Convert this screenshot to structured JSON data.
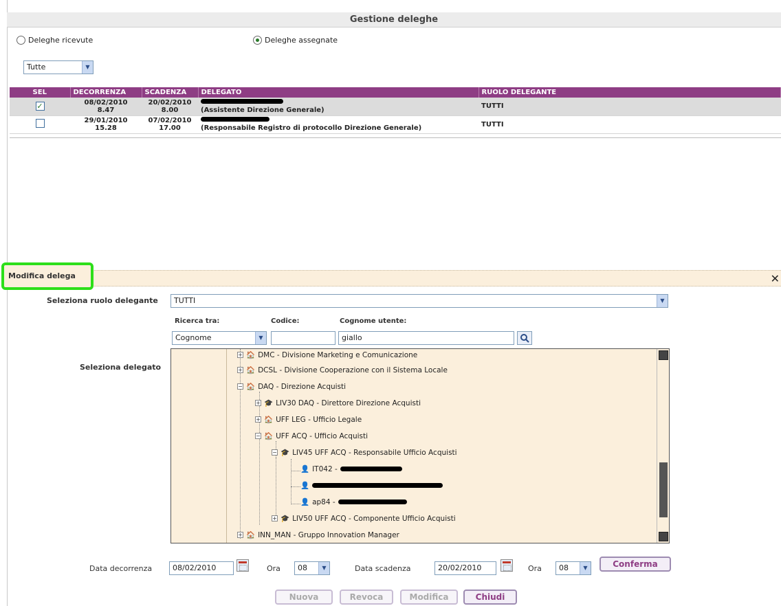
{
  "title": "Gestione deleghe",
  "filters": {
    "radio_received": "Deleghe ricevute",
    "radio_assigned": "Deleghe assegnate",
    "select_value": "Tutte"
  },
  "table": {
    "headers": [
      "SEL",
      "DECORRENZA",
      "SCADENZA",
      "DELEGATO",
      "RUOLO DELEGANTE"
    ],
    "rows": [
      {
        "checked": true,
        "dec_date": "08/02/2010",
        "dec_time": "8.47",
        "sca_date": "20/02/2010",
        "sca_time": "8.00",
        "delegato_role": "(Assistente Direzione Generale)",
        "ruolo": "TUTTI"
      },
      {
        "checked": false,
        "dec_date": "29/01/2010",
        "dec_time": "15.28",
        "sca_date": "07/02/2010",
        "sca_time": "17.00",
        "delegato_role": "(Responsabile Registro di protocollo Direzione Generale)",
        "ruolo": "TUTTI"
      }
    ]
  },
  "edit": {
    "section_title": "Modifica delega",
    "ruolo_label": "Seleziona ruolo delegante",
    "ruolo_value": "TUTTI",
    "ricerca_label": "Ricerca tra:",
    "ricerca_value": "Cognome",
    "codice_label": "Codice:",
    "codice_value": "",
    "cognome_label": "Cognome utente:",
    "cognome_value": "giallo",
    "delegato_label": "Seleziona delegato",
    "tree": [
      "DMC - Divisione Marketing e Comunicazione",
      "DCSL - Divisione Cooperazione con il Sistema Locale",
      "DAQ - Direzione Acquisti",
      "LIV30 DAQ - Direttore Direzione Acquisti",
      "UFF LEG - Ufficio Legale",
      "UFF ACQ - Ufficio Acquisti",
      "LIV45 UFF ACQ - Responsabile Ufficio Acquisti",
      "IT042 -",
      "",
      "ap84 -",
      "LIV50 UFF ACQ - Componente Ufficio Acquisti",
      "INN_MAN - Gruppo Innovation Manager"
    ],
    "data_dec_label": "Data decorrenza",
    "data_dec_value": "08/02/2010",
    "ora_label": "Ora",
    "ora_dec_value": "08",
    "data_sca_label": "Data scadenza",
    "data_sca_value": "20/02/2010",
    "ora_sca_value": "08",
    "confirm": "Conferma"
  },
  "actions": {
    "nuova": "Nuova",
    "revoca": "Revoca",
    "modifica": "Modifica",
    "chiudi": "Chiudi"
  }
}
